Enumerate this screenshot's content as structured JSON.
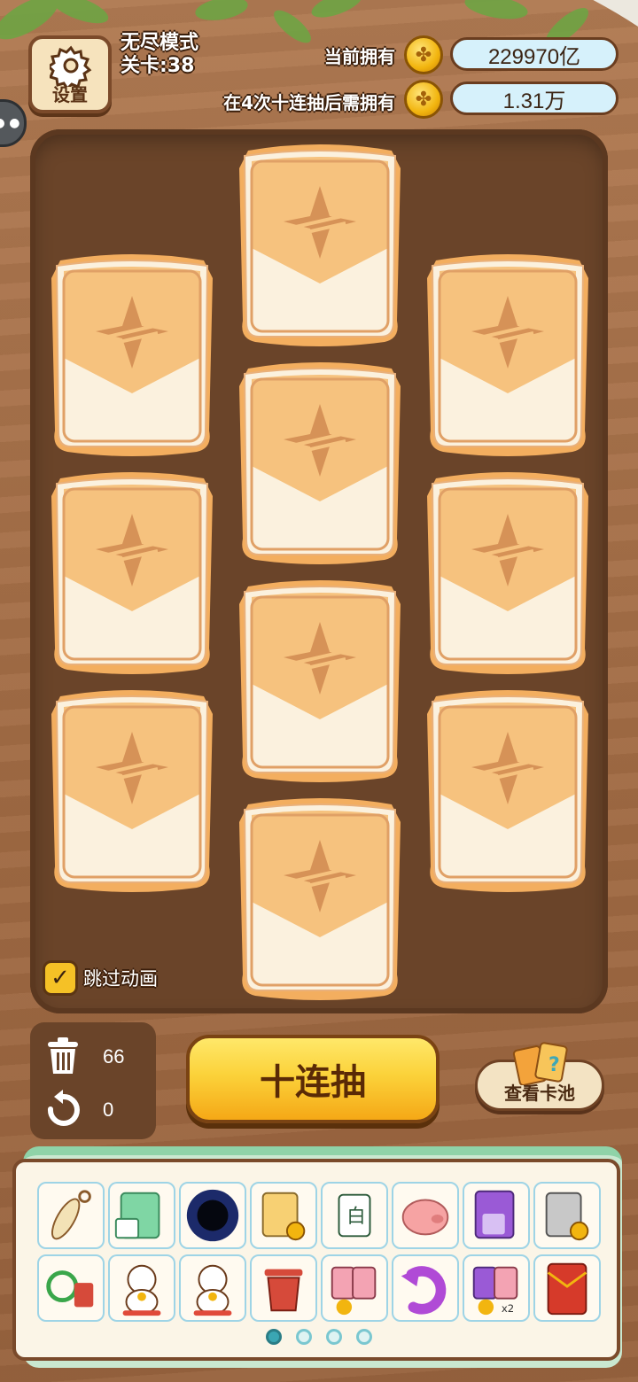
{
  "topbar": {
    "settings_label": "设置",
    "mode": "无尽模式",
    "level": "关卡:38",
    "current_label": "当前拥有",
    "current_value": "229970亿",
    "required_label": "在4次十连抽后需拥有",
    "required_value": "1.31万"
  },
  "board": {
    "card_count": 10,
    "skip_animation_label": "跳过动画",
    "skip_animation_checked": true
  },
  "tools": {
    "trash_count": "66",
    "undo_count": "0"
  },
  "actions": {
    "ten_draw_label": "十连抽",
    "view_pool_label": "查看卡池"
  },
  "tray": {
    "page": 1,
    "page_count": 4,
    "items": [
      "feather-keychain-icon",
      "green-card-pack-icon",
      "black-hole-icon",
      "card-coin-icon",
      "white-tile-icon",
      "pink-pig-icon",
      "purple-card-pack-icon",
      "gray-card-coin-icon",
      "recycle-trash-icon",
      "lucky-cat-icon",
      "lucky-cat-icon",
      "red-trash-can-icon",
      "card-pack-bonus-icon",
      "purple-undo-icon",
      "card-pack-x2-icon",
      "red-envelope-icon"
    ]
  },
  "colors": {
    "board": "#6a4429",
    "card_gold": "#f6c27e",
    "card_cream": "#fbf1de",
    "button_gold": "#fbd23a",
    "value_bg": "#d6f1fb"
  }
}
